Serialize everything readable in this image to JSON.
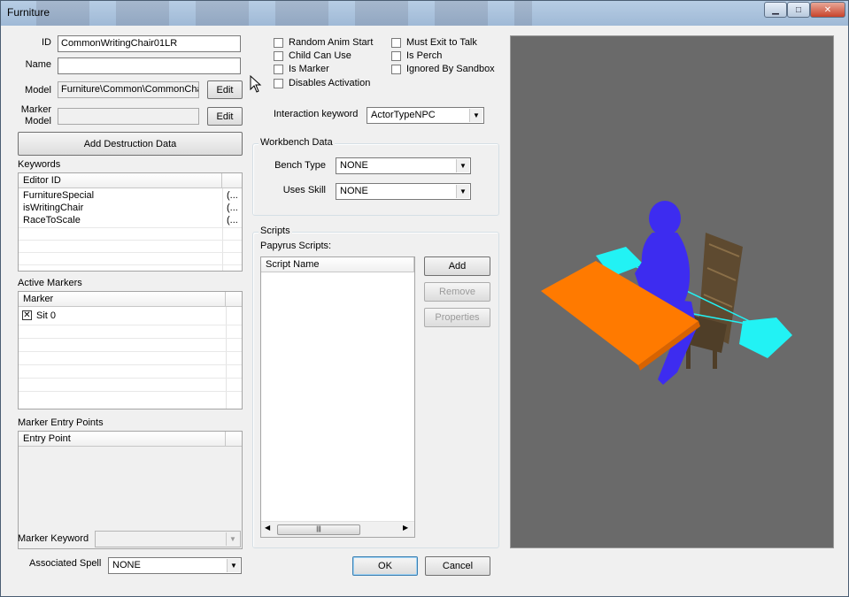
{
  "window": {
    "title": "Furniture"
  },
  "fields": {
    "id_label": "ID",
    "id_value": "CommonWritingChair01LR",
    "name_label": "Name",
    "name_value": "",
    "model_label": "Model",
    "model_value": "Furniture\\Common\\CommonChai",
    "model_edit": "Edit",
    "marker_model_label_1": "Marker",
    "marker_model_label_2": "Model",
    "marker_model_edit": "Edit"
  },
  "add_destruction": "Add Destruction Data",
  "keywords": {
    "label": "Keywords",
    "columns": [
      "Editor ID",
      ""
    ],
    "rows": [
      {
        "id": "FurnitureSpecial",
        "extra": "(..."
      },
      {
        "id": "isWritingChair",
        "extra": "(..."
      },
      {
        "id": "RaceToScale",
        "extra": "(..."
      }
    ]
  },
  "active_markers": {
    "label": "Active Markers",
    "columns": [
      "Marker"
    ],
    "rows": [
      {
        "label": "Sit 0",
        "checked": true
      }
    ]
  },
  "entry_points": {
    "label": "Marker Entry Points",
    "columns": [
      "Entry Point"
    ]
  },
  "marker_keyword": {
    "label": "Marker Keyword",
    "value": ""
  },
  "associated_spell": {
    "label": "Associated Spell",
    "value": "NONE"
  },
  "flags": {
    "random_anim_start": "Random Anim Start",
    "child_can_use": "Child Can Use",
    "is_marker": "Is Marker",
    "disables_activation": "Disables Activation",
    "must_exit_to_talk": "Must Exit to Talk",
    "is_perch": "Is Perch",
    "ignored_by_sandbox": "Ignored By Sandbox"
  },
  "interaction_keyword": {
    "label": "Interaction keyword",
    "value": "ActorTypeNPC"
  },
  "workbench": {
    "label": "Workbench Data",
    "bench_type_label": "Bench Type",
    "bench_type_value": "NONE",
    "uses_skill_label": "Uses Skill",
    "uses_skill_value": "NONE"
  },
  "scripts": {
    "label": "Scripts",
    "papyrus_label": "Papyrus Scripts:",
    "column": "Script Name",
    "add": "Add",
    "remove": "Remove",
    "properties": "Properties"
  },
  "dialog_buttons": {
    "ok": "OK",
    "cancel": "Cancel"
  },
  "colors": {
    "viewport_bg": "#6a6a6a",
    "actor": "#3d2cf0",
    "table": "#ff7a00",
    "marker": "#22f2f4",
    "chair": "#5e4a30"
  }
}
